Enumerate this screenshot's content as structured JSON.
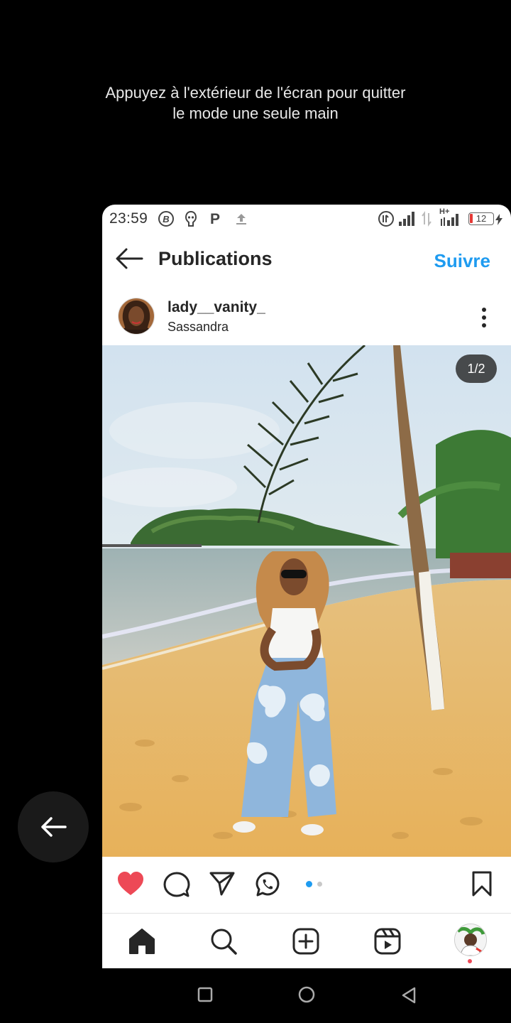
{
  "hint": {
    "line1": "Appuyez à l'extérieur de l'écran pour quitter",
    "line2": "le mode une seule main"
  },
  "status": {
    "time": "23:59",
    "battery": "12",
    "network": "H+",
    "icons_left": [
      "b-circle-icon",
      "alien-notification-icon",
      "p-icon",
      "upload-icon"
    ]
  },
  "header": {
    "title": "Publications",
    "follow_label": "Suivre"
  },
  "post": {
    "username": "lady__vanity_",
    "location": "Sassandra",
    "counter": "1/2",
    "liked": true,
    "carousel": {
      "count": 2,
      "active": 1
    }
  },
  "actions": [
    "heart-icon",
    "comment-icon",
    "share-icon",
    "whatsapp-icon",
    "bookmark-icon"
  ],
  "tabbar": [
    "home-icon",
    "search-icon",
    "create-icon",
    "reels-icon",
    "profile-avatar"
  ],
  "colors": {
    "accent": "#1e9bf0",
    "like": "#ed4956",
    "dot_active": "#1e9bf0",
    "dot_inactive": "#c8c8c8"
  }
}
